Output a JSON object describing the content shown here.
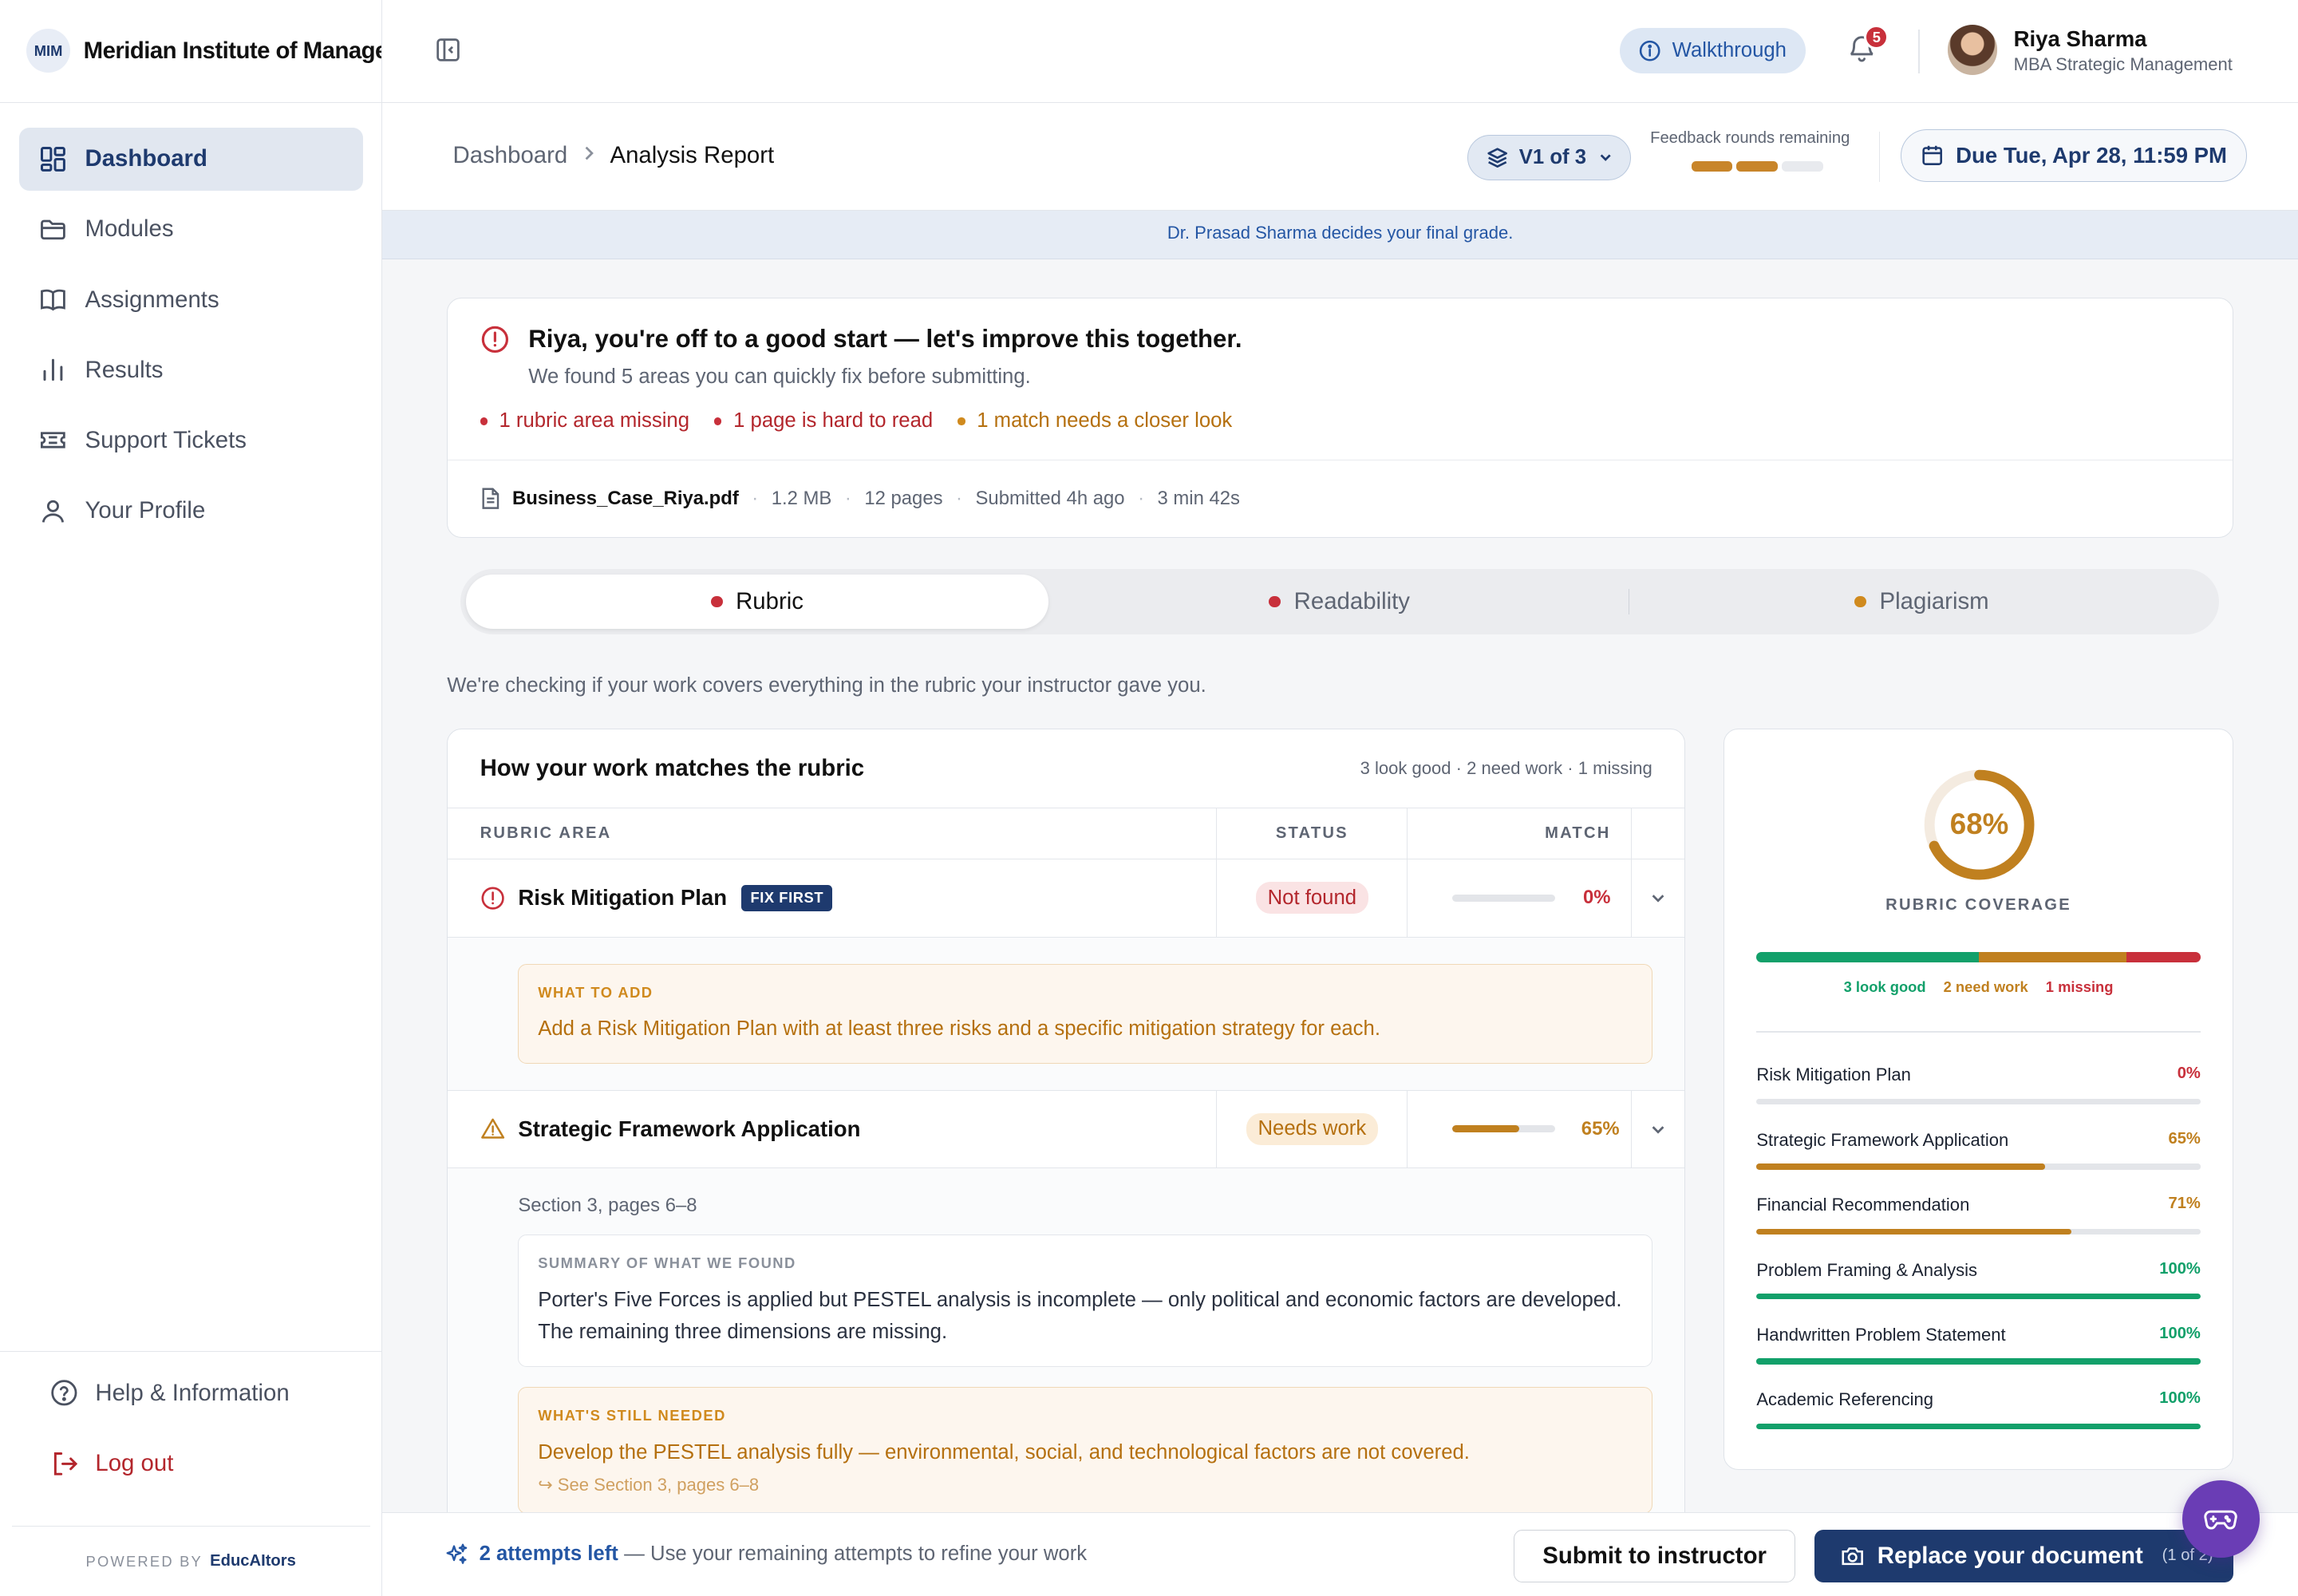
{
  "brand": {
    "logo_text": "MIM",
    "name": "Meridian Institute of Management"
  },
  "sidebar": {
    "items": [
      {
        "label": "Dashboard",
        "icon": "dashboard-icon",
        "active": true
      },
      {
        "label": "Modules",
        "icon": "folder-icon"
      },
      {
        "label": "Assignments",
        "icon": "book-icon"
      },
      {
        "label": "Results",
        "icon": "bar-chart-icon"
      },
      {
        "label": "Support Tickets",
        "icon": "ticket-icon"
      },
      {
        "label": "Your Profile",
        "icon": "user-icon"
      }
    ],
    "help_label": "Help & Information",
    "logout_label": "Log out",
    "powered_by": "POWERED BY",
    "powered_brand": "EducAItors"
  },
  "topbar": {
    "walkthrough_label": "Walkthrough",
    "notification_count": "5",
    "user_name": "Riya Sharma",
    "user_program": "MBA Strategic Management"
  },
  "subheader": {
    "breadcrumb_root": "Dashboard",
    "breadcrumb_current": "Analysis Report",
    "version_label": "V1 of 3",
    "feedback_label": "Feedback rounds remaining",
    "feedback_rounds_total": 3,
    "feedback_rounds_remaining": 2,
    "due_label": "Due Tue, Apr 28, 11:59 PM"
  },
  "banner": {
    "text": "Dr. Prasad Sharma decides your final grade."
  },
  "summary": {
    "title": "Riya, you're off to a good start — let's improve this together.",
    "subtitle": "We found 5 areas you can quickly fix before submitting.",
    "issues": [
      {
        "text": "1 rubric area missing",
        "tone": "red"
      },
      {
        "text": "1 page is hard to read",
        "tone": "red"
      },
      {
        "text": "1 match needs a closer look",
        "tone": "amber"
      }
    ],
    "file": {
      "name": "Business_Case_Riya.pdf",
      "size": "1.2 MB",
      "pages": "12 pages",
      "submitted": "Submitted 4h ago",
      "duration": "3 min 42s"
    }
  },
  "tabs": [
    {
      "label": "Rubric",
      "color": "#c8303b",
      "active": true
    },
    {
      "label": "Readability",
      "color": "#c8303b"
    },
    {
      "label": "Plagiarism",
      "color": "#d08a1e"
    }
  ],
  "intro_text": "We're checking if your work covers everything in the rubric your instructor gave you.",
  "rubric_table": {
    "title": "How your work matches the rubric",
    "meta": "3 look good · 2 need work · 1 missing",
    "headers": {
      "area": "RUBRIC AREA",
      "status": "STATUS",
      "match": "MATCH"
    },
    "rows": [
      {
        "name": "Risk Mitigation Plan",
        "badge": "FIX FIRST",
        "status": "Not found",
        "match_pct": 0,
        "match_label": "0%",
        "note_label": "WHAT TO ADD",
        "note_text": "Add a Risk Mitigation Plan with at least three risks and a specific mitigation strategy for each."
      },
      {
        "name": "Strategic Framework Application",
        "status": "Needs work",
        "match_pct": 65,
        "match_label": "65%",
        "section": "Section 3, pages 6–8",
        "summary_label": "SUMMARY OF WHAT WE FOUND",
        "summary_text": "Porter's Five Forces is applied but PESTEL analysis is incomplete — only political and economic factors are developed. The remaining three dimensions are missing.",
        "needed_label": "WHAT'S STILL NEEDED",
        "needed_text": "Develop the PESTEL analysis fully — environmental, social, and technological factors are not covered.",
        "see_link": "↪ See Section 3, pages 6–8"
      }
    ]
  },
  "coverage": {
    "percent_label": "68%",
    "percent": 68,
    "label": "RUBRIC COVERAGE",
    "segments": [
      {
        "text": "3 look good",
        "color": "#12a06a",
        "share": 50
      },
      {
        "text": "2 need work",
        "color": "#c0801f",
        "share": 33.3
      },
      {
        "text": "1 missing",
        "color": "#c8303b",
        "share": 16.7
      }
    ],
    "items": [
      {
        "name": "Risk Mitigation Plan",
        "pct": 0,
        "label": "0%",
        "color": "#c8303b"
      },
      {
        "name": "Strategic Framework Application",
        "pct": 65,
        "label": "65%",
        "color": "#c0801f"
      },
      {
        "name": "Financial Recommendation",
        "pct": 71,
        "label": "71%",
        "color": "#c0801f"
      },
      {
        "name": "Problem Framing & Analysis",
        "pct": 100,
        "label": "100%",
        "color": "#12a06a"
      },
      {
        "name": "Handwritten Problem Statement",
        "pct": 100,
        "label": "100%",
        "color": "#12a06a"
      },
      {
        "name": "Academic Referencing",
        "pct": 100,
        "label": "100%",
        "color": "#12a06a"
      }
    ]
  },
  "bottombar": {
    "attempts_strong": "2 attempts left",
    "attempts_text": "— Use your remaining attempts to refine your work",
    "submit_label": "Submit to instructor",
    "replace_label": "Replace your document",
    "replace_count": "(1 of 2)"
  },
  "colors": {
    "primary": "#1e3a6e",
    "link": "#2456a4",
    "danger": "#c8303b",
    "warning": "#c0801f",
    "success": "#12a06a",
    "fab": "#6a3db5"
  }
}
